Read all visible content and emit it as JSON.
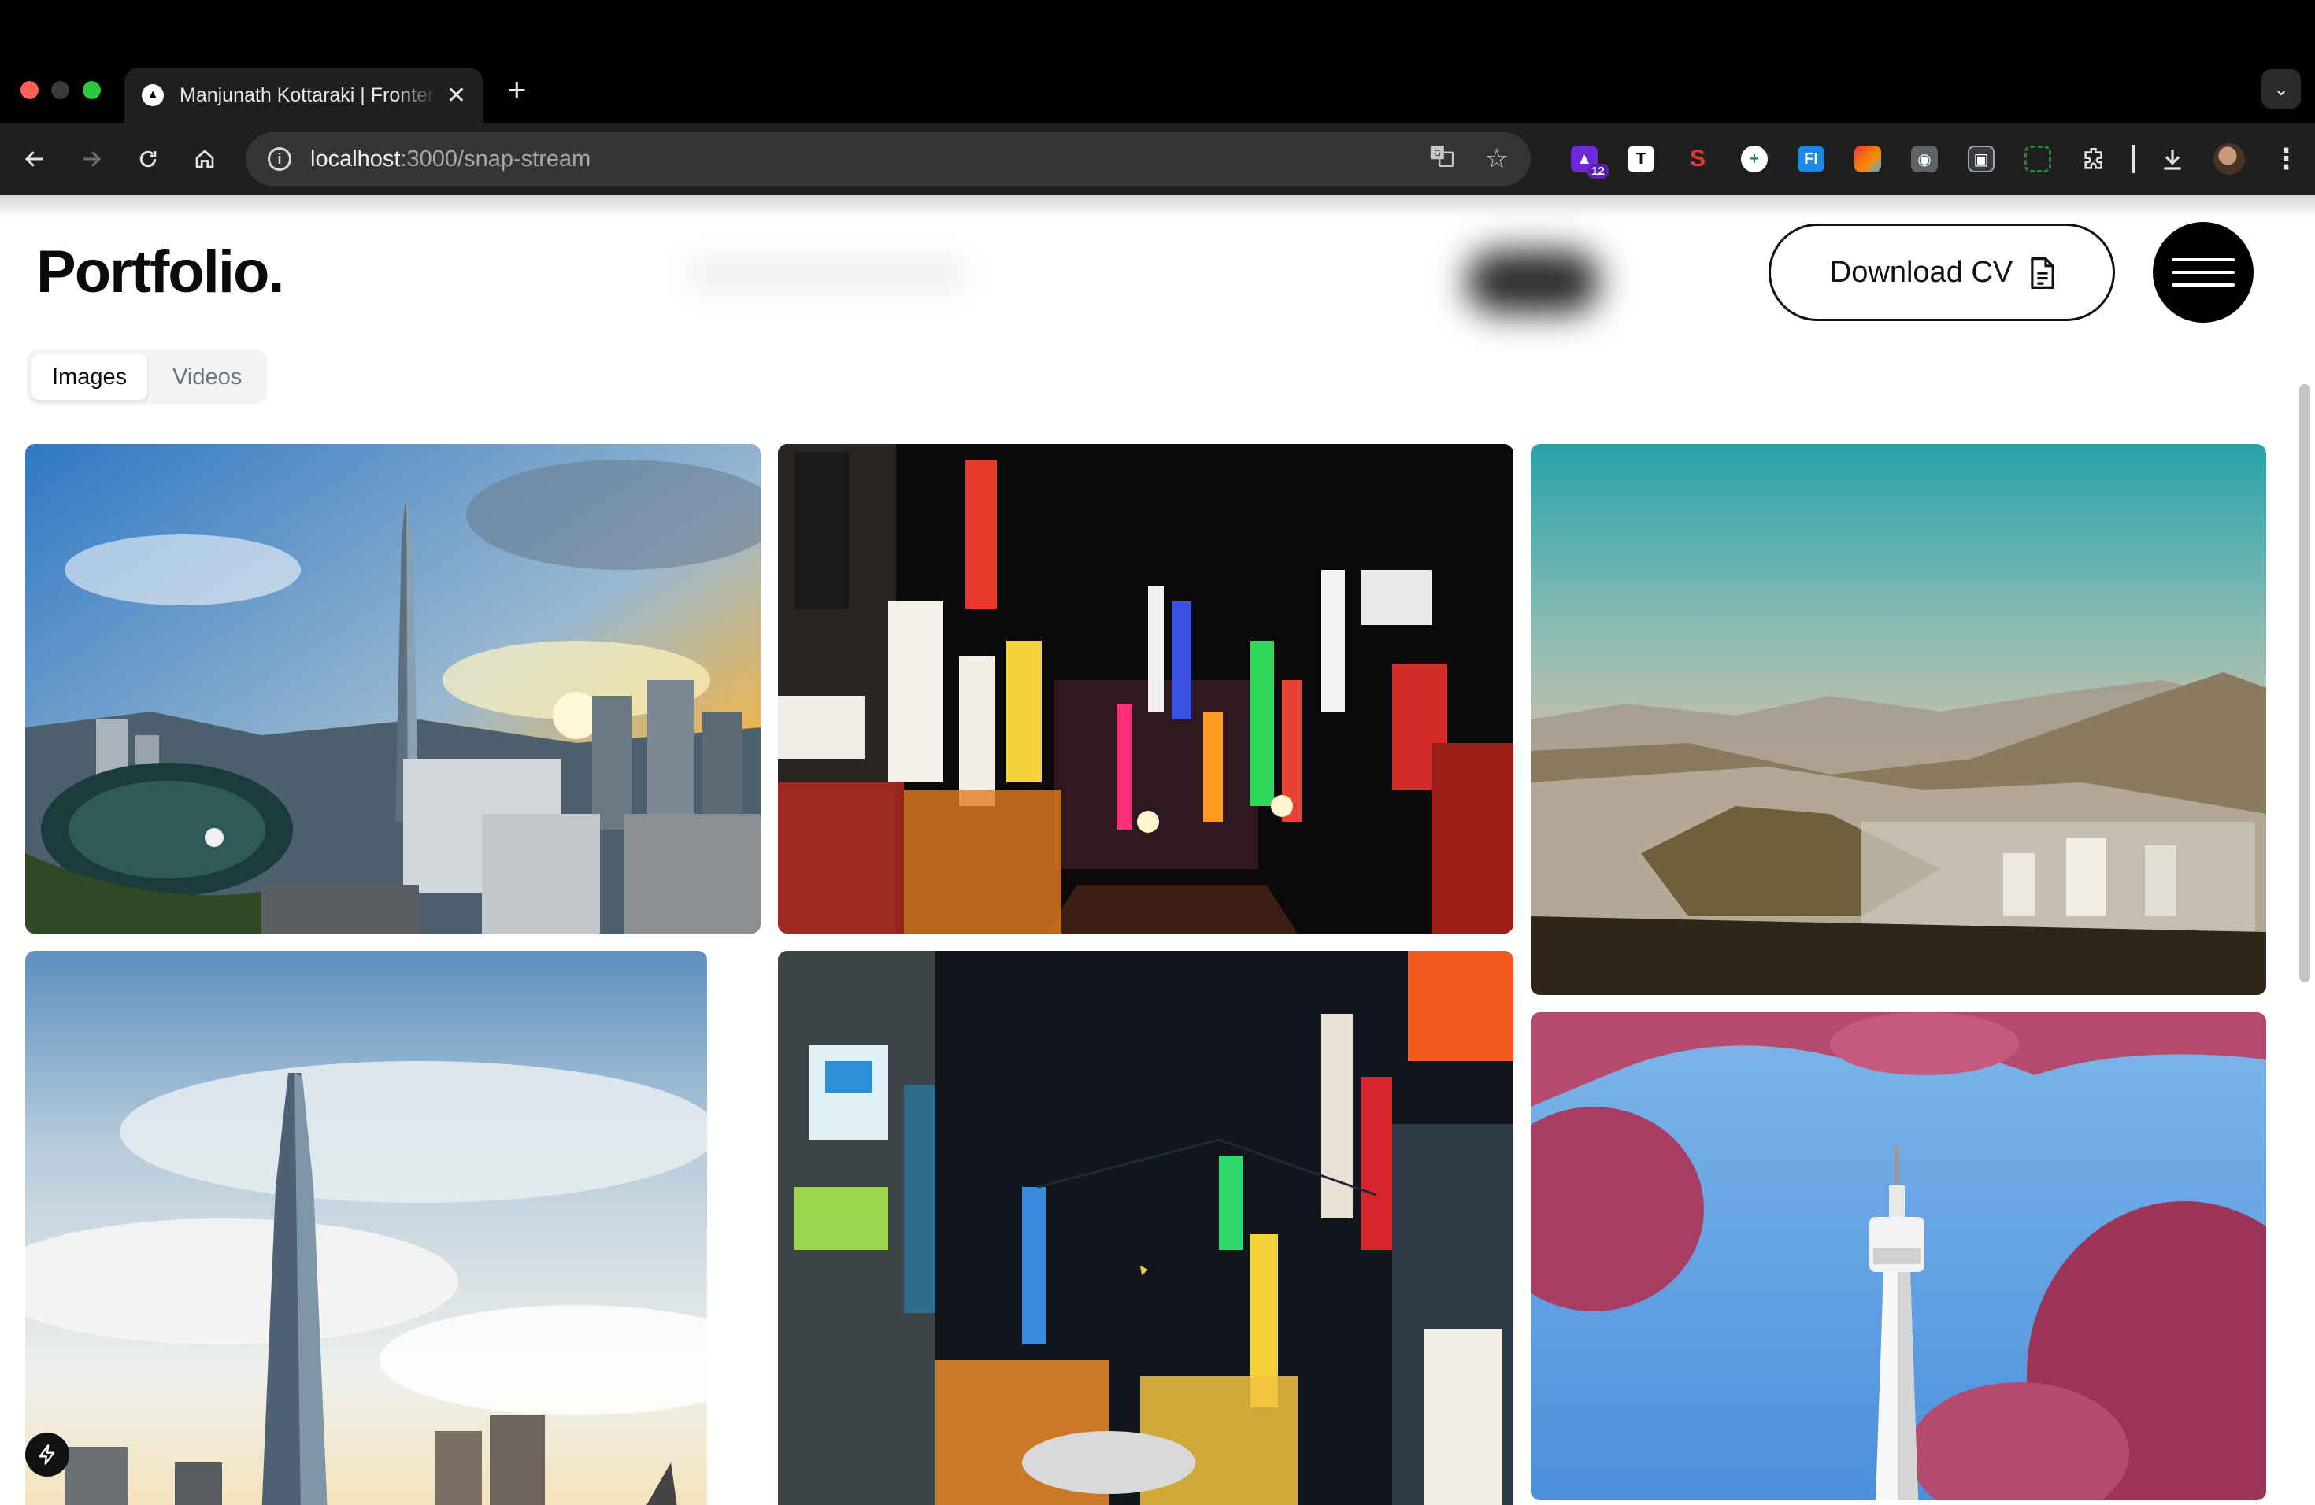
{
  "browser": {
    "tab_title": "Manjunath Kottaraki | Frontend Developer",
    "url_host": "localhost",
    "url_path": ":3000/snap-stream",
    "extension_badge": "12"
  },
  "header": {
    "logo": "Portfolio.",
    "download_cv_label": "Download CV"
  },
  "media_tabs": [
    {
      "label": "Images",
      "active": true
    },
    {
      "label": "Videos",
      "active": false
    }
  ],
  "gallery": [
    {
      "name": "seoul-lotte-tower-skyline-sunset"
    },
    {
      "name": "seoul-neon-alley-night"
    },
    {
      "name": "seoul-mountain-city-view"
    },
    {
      "name": "lotte-world-tower-clouds"
    },
    {
      "name": "seoul-rainy-neon-street"
    },
    {
      "name": "n-seoul-tower-cherry-blossoms"
    }
  ],
  "icons": {
    "back": "arrow-left-icon",
    "forward": "arrow-right-icon",
    "reload": "reload-icon",
    "home": "home-icon",
    "translate": "translate-icon",
    "bookmark": "star-icon",
    "extensions": "puzzle-icon",
    "download": "download-icon",
    "more": "kebab-menu-icon",
    "cv": "document-icon",
    "menu": "hamburger-icon",
    "dev_badge": "lightning-icon"
  },
  "colors": {
    "page_background": "#ffffff",
    "chrome_dark": "#1f1f1f",
    "accent_black": "#0b0b0b"
  }
}
